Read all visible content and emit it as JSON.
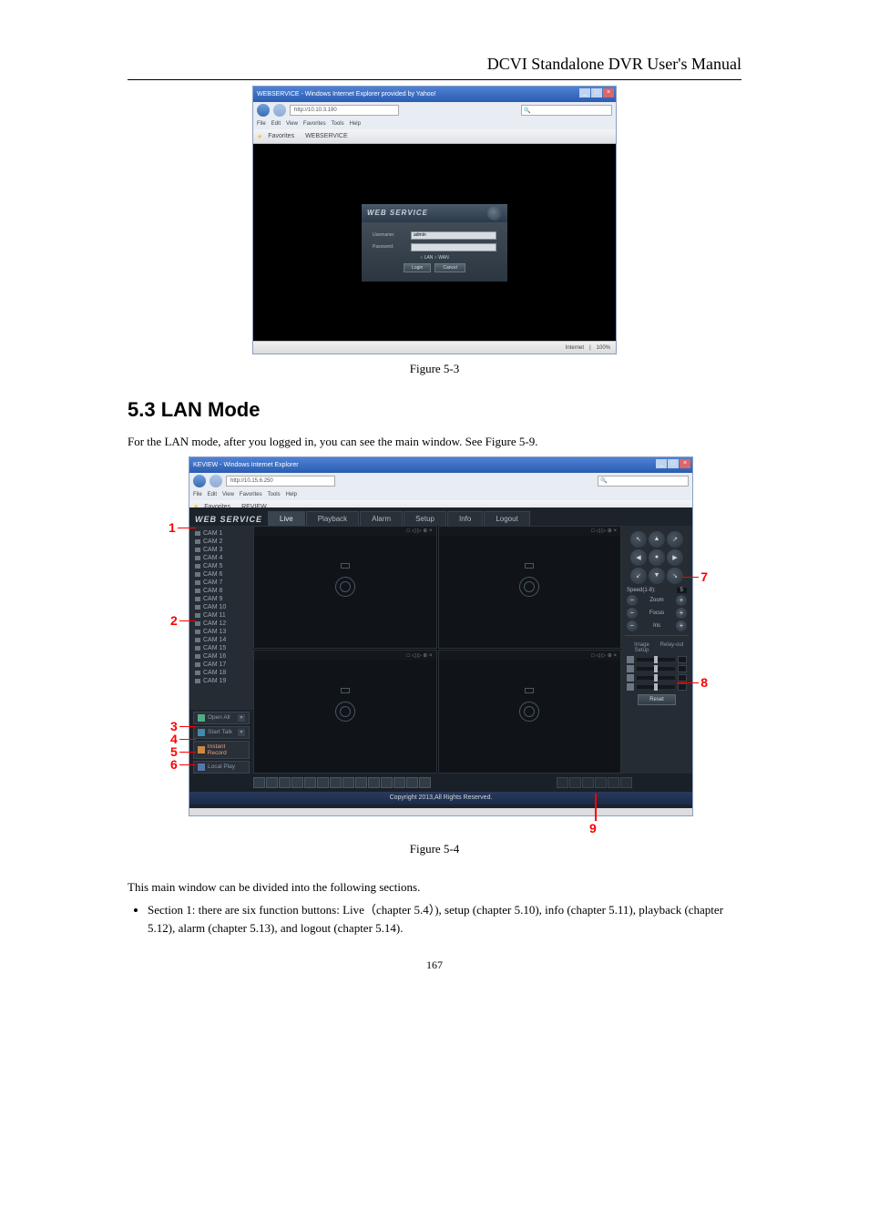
{
  "header": {
    "doc_title": "DCVI Standalone DVR User's Manual"
  },
  "fig53": {
    "title": "WEBSERVICE - Windows Internet Explorer provided by Yahoo!",
    "url_prefix": "http://10.10.3.190",
    "menu": [
      "File",
      "Edit",
      "View",
      "Favorites",
      "Tools",
      "Help"
    ],
    "fav_label": "Favorites",
    "tab_label": "WEBSERVICE",
    "panel_title": "WEB  SERVICE",
    "user_lbl": "Username:",
    "user_val": "admin",
    "pass_lbl": "Password:",
    "radio": "○ LAN  ○ WAN",
    "btn_login": "Login",
    "btn_cancel": "Cancel",
    "status_zone": "Internet",
    "status_zoom": "100%",
    "caption_pre": "Figure 5-3"
  },
  "section": {
    "num_title": "5.3  LAN Mode",
    "intro": "For the LAN mode, after you logged in, you can see the main window. See Figure 5-9.",
    "post": "This main window can be divided into the following sections.",
    "bullet1a": "Section 1: there are six function buttons: Live",
    "bullet1b": "), setup (chapter 5.10), info (chapter 5.11), playback (chapter 5.12), alarm (chapter 5.13), and logout (chapter 5.14).",
    "bullet1_paren": "chapter 5.4",
    "fig54_cap": "Figure 5-4"
  },
  "fig54": {
    "title": "KEVIEW - Windows Internet Explorer",
    "url": "http://10.15.6.250",
    "menu": [
      "File",
      "Edit",
      "View",
      "Favorites",
      "Tools",
      "Help"
    ],
    "fav_label": "Favorites",
    "tab_label": "REVIEW",
    "logo": "WEB SERVICE",
    "tabs": [
      "Live",
      "Playback",
      "Alarm",
      "Setup",
      "Info",
      "Logout"
    ],
    "cams": [
      "CAM 1",
      "CAM 2",
      "CAM 3",
      "CAM 4",
      "CAM 5",
      "CAM 6",
      "CAM 7",
      "CAM 8",
      "CAM 9",
      "CAM 10",
      "CAM 11",
      "CAM 12",
      "CAM 13",
      "CAM 14",
      "CAM 15",
      "CAM 16",
      "CAM 17",
      "CAM 18",
      "CAM 19"
    ],
    "side_buttons": {
      "open_all": "Open All",
      "start_talk": "Start Talk",
      "instant": "Instant Record",
      "local": "Local Play"
    },
    "ptz": {
      "speed": "Speed(1-8):",
      "zoom": "Zoom",
      "focus": "Focus",
      "iris": "Iris",
      "img_tab1": "Image Setup",
      "img_tab2": "Relay-out",
      "reset": "Reset"
    },
    "copyright": "Copyright 2013,All Rights Reserved.",
    "vcell_icons": "□ ◁ ▷ ⊕ ×"
  },
  "ann": {
    "n1": "1",
    "n2": "2",
    "n3": "3",
    "n4": "4",
    "n5": "5",
    "n6": "6",
    "n7": "7",
    "n8": "8",
    "n9": "9"
  },
  "page_num": "167"
}
